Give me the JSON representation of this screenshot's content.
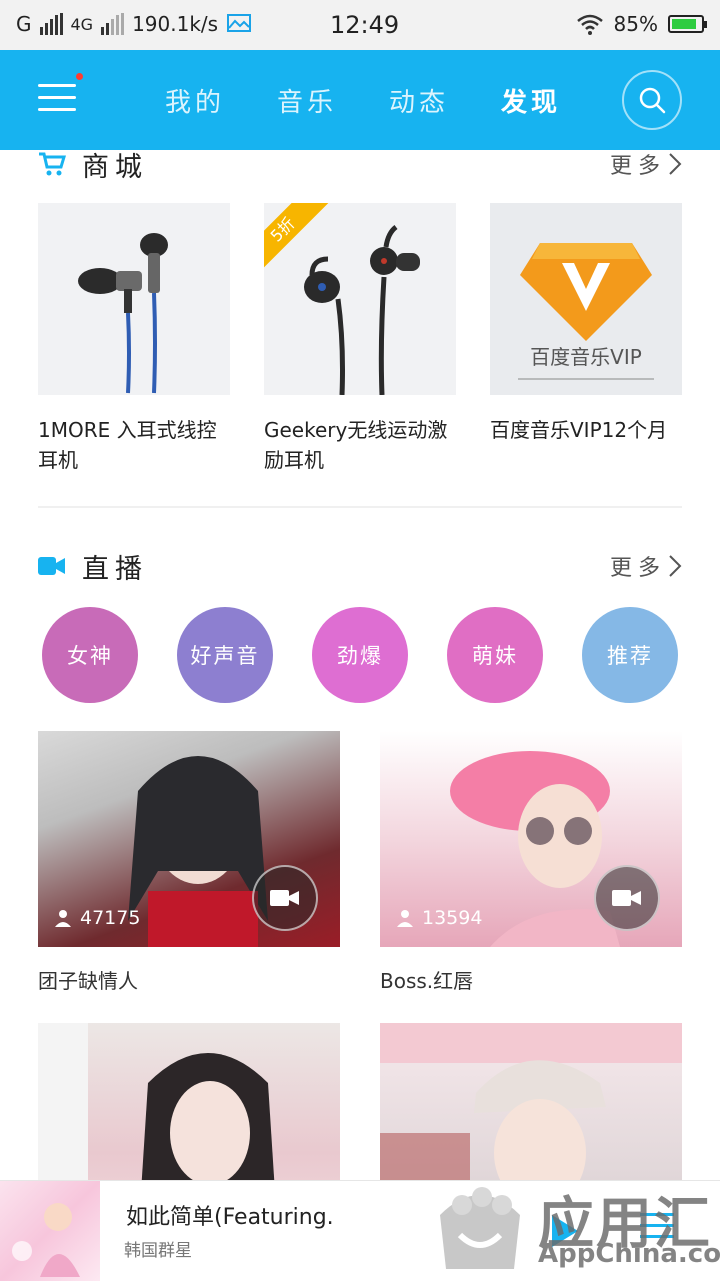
{
  "status_bar": {
    "carrier1": "G",
    "carrier2": "4G",
    "net_speed": "190.1k/s",
    "time": "12:49",
    "battery": "85%",
    "battery_level": 0.85
  },
  "nav": {
    "tabs": [
      {
        "label": "我的",
        "active": false
      },
      {
        "label": "音乐",
        "active": false
      },
      {
        "label": "动态",
        "active": false
      },
      {
        "label": "发现",
        "active": true
      }
    ],
    "menu_icon": "hamburger-icon",
    "search_icon": "search-icon",
    "accent": "#17b3f0"
  },
  "mall": {
    "title": "商城",
    "more": "更多",
    "products": [
      {
        "name": "1MORE 入耳式线控耳机",
        "badge": ""
      },
      {
        "name": "Geekery无线运动激励耳机",
        "badge": "5折"
      },
      {
        "name": "百度音乐VIP12个月",
        "badge": "",
        "thumb_text": "百度音乐VIP"
      }
    ]
  },
  "live": {
    "title": "直播",
    "more": "更多",
    "categories": [
      {
        "label": "女神",
        "color": "#c86bb8"
      },
      {
        "label": "好声音",
        "color": "#8d7fd0"
      },
      {
        "label": "劲爆",
        "color": "#de6ed2"
      },
      {
        "label": "萌妹",
        "color": "#e06ec4"
      },
      {
        "label": "推荐",
        "color": "#85b8e6"
      }
    ],
    "streams": [
      {
        "name": "团子缺情人",
        "viewers": "47175"
      },
      {
        "name": "Boss.红唇",
        "viewers": "13594"
      },
      {
        "name": "",
        "viewers": ""
      },
      {
        "name": "",
        "viewers": ""
      }
    ]
  },
  "player": {
    "song": "如此简单(Featuring.",
    "artist": "韩国群星"
  },
  "watermark": {
    "cn": "应用汇",
    "en": "AppChina.com"
  }
}
